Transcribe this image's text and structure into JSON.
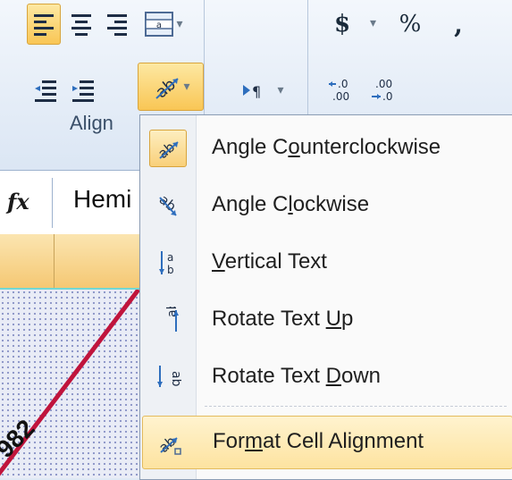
{
  "ribbon": {
    "align_left_icon": "align-left-icon",
    "center_icon": "align-center-icon",
    "align_right_icon": "align-right-icon",
    "merge_icon": "merge-cells-icon",
    "decrease_indent_icon": "decrease-indent-icon",
    "increase_indent_icon": "increase-indent-icon",
    "orientation_icon": "text-orientation-icon",
    "text_direction_icon": "text-direction-icon",
    "currency_glyph": "$",
    "percent_glyph": "%",
    "comma_glyph": ",",
    "increase_decimal_glyph": "←.0 .00",
    "decrease_decimal_glyph": ".00 →.0",
    "alignment_group_label": "Align"
  },
  "formula_bar": {
    "fx_label": "fx",
    "value_visible": "Hemi"
  },
  "sheet": {
    "cell_value_visible": "982"
  },
  "menu": {
    "items": [
      {
        "pre": "Angle C",
        "key": "o",
        "post": "unterclockwise",
        "icon": "angle-counterclockwise-icon",
        "checked": true
      },
      {
        "pre": "Angle C",
        "key": "l",
        "post": "ockwise",
        "icon": "angle-clockwise-icon",
        "checked": false
      },
      {
        "pre": "",
        "key": "V",
        "post": "ertical Text",
        "icon": "vertical-text-icon",
        "checked": false
      },
      {
        "pre": "Rotate Text ",
        "key": "U",
        "post": "p",
        "icon": "rotate-text-up-icon",
        "checked": false
      },
      {
        "pre": "Rotate Text ",
        "key": "D",
        "post": "own",
        "icon": "rotate-text-down-icon",
        "checked": false
      },
      {
        "pre": "For",
        "key": "m",
        "post": "at Cell Alignment",
        "icon": "format-cell-alignment-icon",
        "checked": false
      }
    ]
  },
  "colors": {
    "selected_button": "#f9c655",
    "menu_hover": "#fde3a0",
    "cell_diagonal_border": "#c0143c"
  }
}
